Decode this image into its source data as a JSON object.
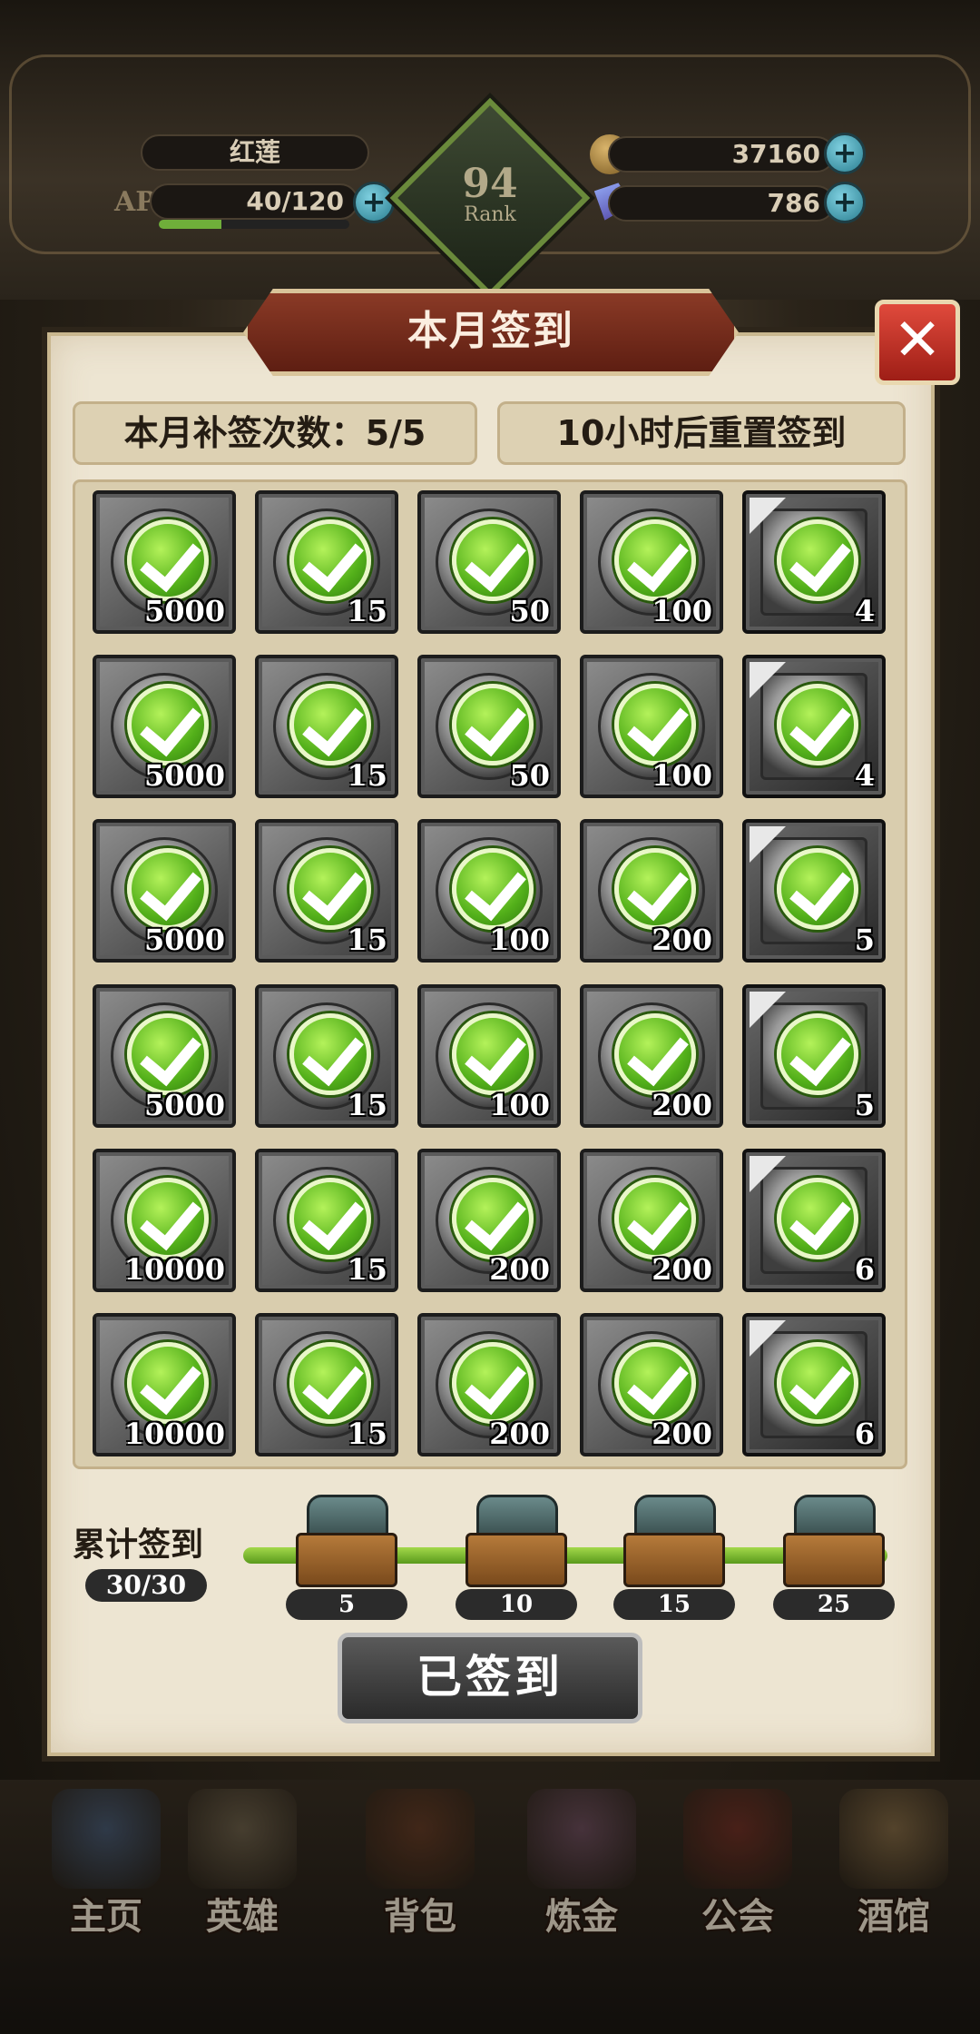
{
  "header": {
    "player_name": "红莲",
    "ap_label": "AP",
    "ap_value": "40/120",
    "ap_fraction": 0.33,
    "gold": "37160",
    "gems": "786",
    "rank_number": "94",
    "rank_label": "Rank"
  },
  "dialog": {
    "title": "本月签到",
    "makeup_text": "本月补签次数：5/5",
    "reset_text": "10小时后重置签到",
    "rows": [
      [
        "5000",
        "15",
        "50",
        "100",
        "4"
      ],
      [
        "5000",
        "15",
        "50",
        "100",
        "4"
      ],
      [
        "5000",
        "15",
        "100",
        "200",
        "5"
      ],
      [
        "5000",
        "15",
        "100",
        "200",
        "5"
      ],
      [
        "10000",
        "15",
        "200",
        "200",
        "6"
      ],
      [
        "10000",
        "15",
        "200",
        "200",
        "6"
      ]
    ],
    "cumulative_label": "累计签到",
    "cumulative_count": "30/30",
    "cumulative_fraction": 1.0,
    "milestones": [
      "5",
      "10",
      "15",
      "25"
    ],
    "signed_button": "已签到"
  },
  "nav": {
    "items": [
      "主页",
      "英雄",
      "背包",
      "炼金",
      "公会",
      "酒馆"
    ]
  },
  "colors": {
    "accent_green": "#6fbf2a",
    "ribbon_red": "#7a2a1a",
    "close_red": "#c8322a"
  }
}
